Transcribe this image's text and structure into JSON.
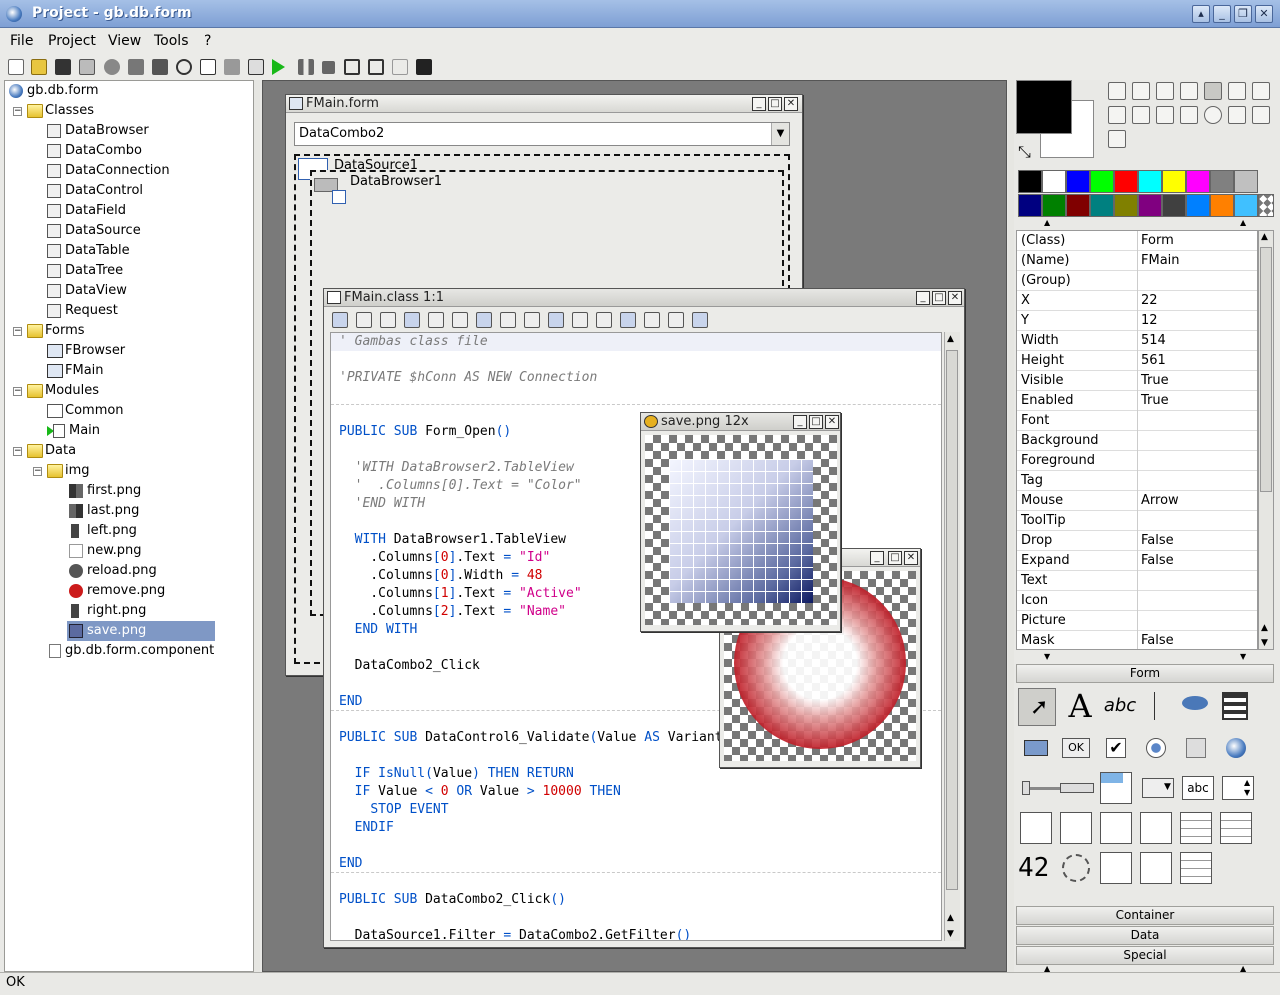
{
  "window": {
    "title": "Project - gb.db.form"
  },
  "menu": [
    "File",
    "Project",
    "View",
    "Tools",
    "?"
  ],
  "tree": {
    "root": "gb.db.form",
    "classes_label": "Classes",
    "classes": [
      "DataBrowser",
      "DataCombo",
      "DataConnection",
      "DataControl",
      "DataField",
      "DataSource",
      "DataTable",
      "DataTree",
      "DataView",
      "Request"
    ],
    "forms_label": "Forms",
    "forms": [
      "FBrowser",
      "FMain"
    ],
    "modules_label": "Modules",
    "modules": [
      "Common",
      "Main"
    ],
    "data_label": "Data",
    "img_label": "img",
    "images": [
      "first.png",
      "last.png",
      "left.png",
      "new.png",
      "reload.png",
      "remove.png",
      "right.png",
      "save.png"
    ],
    "component_file": "gb.db.form.component"
  },
  "form_window": {
    "title": "FMain.form",
    "combo_value": "DataCombo2",
    "datasource_label": "DataSource1",
    "databrowser_label": "DataBrowser1"
  },
  "class_window": {
    "title": "FMain.class 1:1",
    "lines": [
      "' Gambas class file",
      "",
      "'PRIVATE $hConn AS NEW Connection",
      "",
      "PUBLIC SUB Form_Open()",
      "",
      "  'WITH DataBrowser2.TableView",
      "  '  .Columns[0].Text = \"Color\"",
      "  'END WITH",
      "",
      "  WITH DataBrowser1.TableView",
      "    .Columns[0].Text = \"Id\"",
      "    .Columns[0].Width = 48",
      "    .Columns[1].Text = \"Active\"",
      "    .Columns[2].Text = \"Name\"",
      "  END WITH",
      "",
      "  DataCombo2_Click",
      "",
      "END",
      "PUBLIC SUB DataControl6_Validate(Value AS Variant)",
      "",
      "  IF IsNull(Value) THEN RETURN",
      "  IF Value < 0 OR Value > 10000 THEN",
      "    STOP EVENT",
      "  ENDIF",
      "",
      "END",
      "PUBLIC SUB DataCombo2_Click()",
      "",
      "  DataSource1.Filter = DataCombo2.GetFilter()"
    ]
  },
  "image_window": {
    "title": "save.png 12x"
  },
  "properties": [
    [
      "(Class)",
      "Form"
    ],
    [
      "(Name)",
      "FMain"
    ],
    [
      "(Group)",
      ""
    ],
    [
      "X",
      "22"
    ],
    [
      "Y",
      "12"
    ],
    [
      "Width",
      "514"
    ],
    [
      "Height",
      "561"
    ],
    [
      "Visible",
      "True"
    ],
    [
      "Enabled",
      "True"
    ],
    [
      "Font",
      ""
    ],
    [
      "Background",
      ""
    ],
    [
      "Foreground",
      ""
    ],
    [
      "Tag",
      ""
    ],
    [
      "Mouse",
      "Arrow"
    ],
    [
      "ToolTip",
      ""
    ],
    [
      "Drop",
      "False"
    ],
    [
      "Expand",
      "False"
    ],
    [
      "Text",
      ""
    ],
    [
      "Icon",
      ""
    ],
    [
      "Picture",
      ""
    ],
    [
      "Mask",
      "False"
    ]
  ],
  "toolbox": {
    "form_tab": "Form",
    "ok_label": "OK",
    "abc_label": "abc",
    "abc2_label": "abc",
    "lcd_label": "42",
    "container_tab": "Container",
    "data_tab": "Data",
    "special_tab": "Special"
  },
  "palette": [
    "#000000",
    "#ffffff",
    "#0000ff",
    "#00ff00",
    "#ff0000",
    "#00ffff",
    "#ffff00",
    "#ff00ff",
    "#808080",
    "#c0c0c0",
    "#000080",
    "#008000",
    "#800000",
    "#008080",
    "#808000",
    "#800080",
    "#404040",
    "#0080ff",
    "#ff8000",
    "#40c0ff"
  ],
  "status": "OK"
}
